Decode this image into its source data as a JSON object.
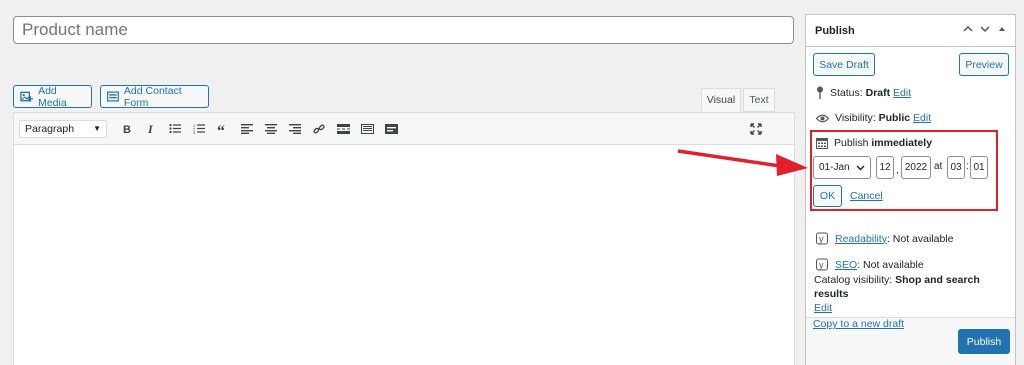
{
  "title_field": {
    "placeholder": "Product name"
  },
  "media_buttons": {
    "add_media": "Add Media",
    "add_contact_form": "Add Contact Form"
  },
  "editor": {
    "tabs": {
      "visual": "Visual",
      "text": "Text"
    },
    "format_select": "Paragraph",
    "toolbar_icons": [
      "bold-icon",
      "italic-icon",
      "bulleted-list-icon",
      "numbered-list-icon",
      "blockquote-icon",
      "align-left-icon",
      "align-center-icon",
      "align-right-icon",
      "link-icon",
      "read-more-icon",
      "toolbar-toggle-icon",
      "form-icon",
      "fullscreen-icon"
    ]
  },
  "publish": {
    "title": "Publish",
    "save_draft": "Save Draft",
    "preview": "Preview",
    "status_label": "Status:",
    "status_value": "Draft",
    "visibility_label": "Visibility:",
    "visibility_value": "Public",
    "edit": "Edit",
    "schedule_label": "Publish",
    "schedule_value": "immediately",
    "month": "01-Jan",
    "day": "12",
    "year": "2022",
    "at": "at",
    "hour": "03",
    "minute": "01",
    "ok": "OK",
    "cancel": "Cancel",
    "readability_label": "Readability",
    "readability_value": ": Not available",
    "seo_label": "SEO",
    "seo_value": ": Not available",
    "catalog_label": "Catalog visibility:",
    "catalog_value": "Shop and search results",
    "copy_draft": "Copy to a new draft",
    "publish_button": "Publish"
  },
  "colors": {
    "accent": "#2271b1",
    "annotation": "#e0202a",
    "background": "#f0f0f1"
  }
}
